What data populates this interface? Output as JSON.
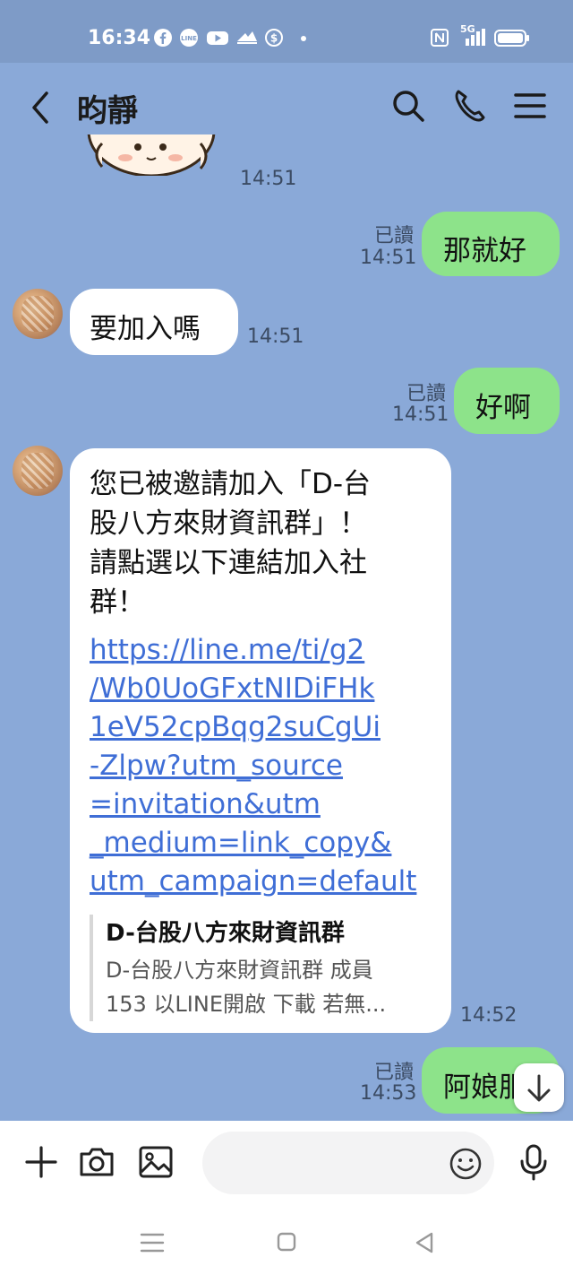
{
  "status_bar": {
    "time": "16:34",
    "network": "5G",
    "icons": [
      "facebook-icon",
      "line-icon",
      "youtube-icon",
      "app-icon",
      "dollar-icon",
      "dot-icon",
      "nfc-icon",
      "signal-icon",
      "battery-icon"
    ],
    "app_icon_text": "LINE"
  },
  "header": {
    "title": "昀靜",
    "back_icon": "back-arrow-icon",
    "search_icon": "search-icon",
    "call_icon": "phone-icon",
    "menu_icon": "menu-icon"
  },
  "messages": [
    {
      "id": "m0",
      "type": "sticker",
      "direction": "in",
      "time": "14:51"
    },
    {
      "id": "m1",
      "direction": "out",
      "text": "那就好",
      "read": "已讀",
      "time": "14:51"
    },
    {
      "id": "m2",
      "direction": "in",
      "text": "要加入嗎",
      "time": "14:51"
    },
    {
      "id": "m3",
      "direction": "out",
      "text": "好啊",
      "read": "已讀",
      "time": "14:51"
    },
    {
      "id": "m4",
      "direction": "in",
      "time": "14:52",
      "text_lines": [
        "您已被邀請加入「D-台",
        "股八方來財資訊群」！",
        "請點選以下連結加入社",
        "群！"
      ],
      "link_lines": [
        "https://line.me/ti/g2",
        "/Wb0UoGFxtNIDiFHk",
        "1eV52cpBqg2suCgUi",
        "-Zlpw?utm_source",
        "=invitation&utm",
        "_medium=link_copy&",
        "utm_campaign=default"
      ],
      "preview": {
        "title": "D-台股八方來財資訊群",
        "desc_lines": [
          "D-台股八方來財資訊群 成員",
          "153 以LINE開啟 下載 若無..."
        ]
      }
    },
    {
      "id": "m5",
      "direction": "out",
      "text": "阿娘服",
      "read": "已讀",
      "time": "14:53"
    }
  ],
  "scroll_down_icon": "arrow-down-icon",
  "input_bar": {
    "add_icon": "plus-icon",
    "camera_icon": "camera-icon",
    "image_icon": "image-icon",
    "placeholder": "",
    "emoji_icon": "emoji-icon",
    "mic_icon": "microphone-icon"
  },
  "nav_bar": {
    "recents_icon": "recents-icon",
    "home_icon": "home-icon",
    "back_icon": "nav-back-icon"
  },
  "colors": {
    "chat_background": "#8aa9d8",
    "outgoing_bubble": "#8de38a",
    "incoming_bubble": "#ffffff",
    "link": "#3f6ed6"
  }
}
